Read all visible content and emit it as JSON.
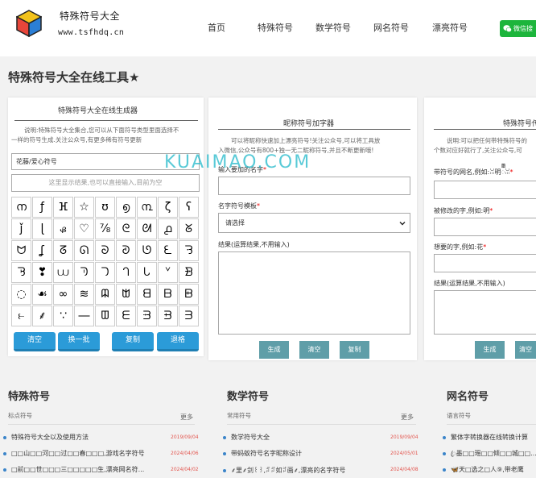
{
  "header": {
    "site_name": "特殊符号大全",
    "site_url": "www.tsfhdq.cn",
    "nav": [
      "首页",
      "特殊符号",
      "数学符号",
      "网名符号",
      "漂亮符号"
    ],
    "wechat_label": "微信搜"
  },
  "page_title": "特殊符号大全在线工具★",
  "generator": {
    "title": "特殊符号大全在线生成器",
    "desc_line1": "说明:特殊符号大全集合,您可以从下面符号类型里面选择不",
    "desc_line2": "一样的符号生成.关注公众号,有更多稀有符号更新",
    "style_value": "花藤/爱心符号",
    "result_placeholder": "这里显示结果,也可以直接输入,目前为空",
    "symbols": [
      "ന",
      "ƒ",
      "ⴼ",
      "☆",
      "ʊ",
      "൭",
      "൩",
      "ζ",
      "ʕ",
      "ǰ",
      "ɭ",
      "ᏸ",
      "♡",
      "⅞",
      "ᘓ",
      "ᘛ",
      "൧",
      "ᘜ",
      "ᗢ",
      "ʆ",
      "ᘔ",
      "ᘏ",
      "ᘐ",
      "ᘑ",
      "ᘎ",
      "ᘍ",
      "ᘌ",
      "ᘋ",
      "❣",
      "⩊",
      "ᘅ",
      "ᘄ",
      "ᘃ",
      "ᘂ",
      "ᘁ",
      "ᗿ",
      "◌",
      "☙",
      "∞",
      "≋",
      "ᗼ",
      "ᗻ",
      "ᗺ",
      "ᗹ",
      "ᗸ",
      "⥼",
      "⸙",
      "∵",
      "―",
      "ᗵ",
      "ᗴ",
      "ᗳ",
      "ᗲ",
      "ᗱ"
    ],
    "buttons": [
      "清空",
      "换一批",
      "复制",
      "退格"
    ]
  },
  "nickname": {
    "title": "昵称符号加字器",
    "desc_line1": "可以将昵称快速加上漂亮符号!关注公众号,可以将工具放",
    "desc_line2": "入微信,公众号有800+独一无二昵称符号,并且不断更新哦!",
    "field1_label": "输入要加的名字",
    "field2_label": "名字符号模板",
    "select_value": "请选择",
    "field3_label": "结果(运算结果,不用输入)",
    "buttons": [
      "生成",
      "清空",
      "复制"
    ]
  },
  "third": {
    "title": "特殊符号传",
    "desc_line1": "说明:可以把任何带特殊符号的",
    "desc_line2": "个数对应好就行了,关注公众号,可",
    "field1_label": "带符号的网名,例如:ꈍ明ᢆꈍ",
    "field2_label": "被修改的字,例如:明",
    "field3_label": "想要的字,例如:花",
    "field4_label": "结果(运算结果,不用输入)",
    "buttons": [
      "生成",
      "清空"
    ]
  },
  "watermark_text": "KUAIMAO.COM",
  "sections": [
    {
      "title": "特殊符号",
      "sub": "标点符号",
      "more": "更多",
      "articles": [
        {
          "text": "特殊符号大全以及使用方法",
          "date": "2019/09/04"
        },
        {
          "text": "□□山□□河□□过□□春□□□,游戏名字符号",
          "date": "2024/04/06"
        },
        {
          "text": "□前□□世□□□三□□□□□生,漂亮网名符...",
          "date": "2024/04/02"
        }
      ]
    },
    {
      "title": "数学符号",
      "sub": "常用符号",
      "more": "更多",
      "articles": [
        {
          "text": "数学符号大全",
          "date": "2019/09/04"
        },
        {
          "text": "带蚂蚁符号名字昵称设计",
          "date": "2024/05/01"
        },
        {
          "text": "⸙里⸙剑꒰꒱,ꄂꄂ如ꄂ画⸙,漂亮的名字符号",
          "date": "2024/04/08"
        }
      ]
    },
    {
      "title": "网名符号",
      "sub": "语言符号",
      "more": "",
      "articles": [
        {
          "text": "繁体字转换器在线转换计算",
          "date": ""
        },
        {
          "text": "ꦿ墨□□瑶□□倾□□城□□...",
          "date": ""
        },
        {
          "text": "🦋天□选之□人⑨,带老鹰",
          "date": ""
        }
      ]
    }
  ],
  "colors": {
    "accent_blue": "#2b9bd8",
    "teal": "#5f9ea8",
    "wechat_green": "#1db53c",
    "date_red": "#e3564f",
    "dot_blue": "#3a84c9"
  }
}
